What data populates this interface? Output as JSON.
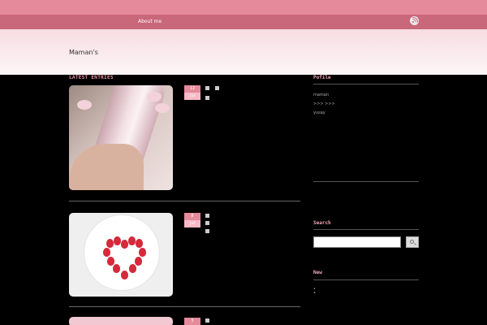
{
  "topbar": {
    "text": ""
  },
  "nav": {
    "about": "About me",
    "item2": ""
  },
  "header": {
    "site_title": "Maman's"
  },
  "sections": {
    "latest": "LATEST ENTRIES"
  },
  "posts": [
    {
      "day": "12",
      "month": "Jul",
      "meta1": "",
      "meta2": "",
      "meta3": "",
      "title": "",
      "excerpt": ""
    },
    {
      "day": "8",
      "month": "Jul",
      "meta1": "",
      "meta2": "",
      "meta3": "",
      "title": "",
      "excerpt": ""
    },
    {
      "day": "3",
      "month": "",
      "meta1": "",
      "meta2": "",
      "meta3": "",
      "title": "",
      "excerpt": ""
    }
  ],
  "sidebar": {
    "profile_title": "Pofile",
    "profile_text1": "maman",
    "profile_text2": ">>> >>>",
    "profile_text3": "yusay",
    "profile_text4": "",
    "categories_title": "",
    "category1": "",
    "category2": "",
    "category3": "",
    "search_title": "Search",
    "new_title": "New",
    "new_items": [
      "",
      "",
      ""
    ]
  },
  "colors": {
    "topbar": "#e58a9a",
    "navbar": "#c9677b",
    "accent_text": "#f0a7b5",
    "date_day_bg": "#e58a9a",
    "date_month_bg": "#f6b9c5",
    "page_bg": "#000000"
  },
  "icons": {
    "rss": "rss-icon",
    "search": "search-icon"
  }
}
